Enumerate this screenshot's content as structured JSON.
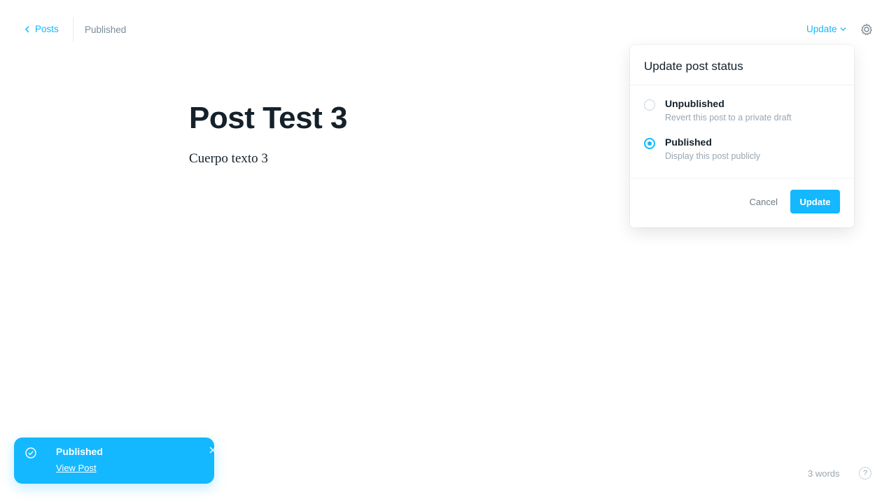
{
  "header": {
    "back_label": "Posts",
    "status_label": "Published",
    "update_label": "Update"
  },
  "editor": {
    "title": "Post Test 3",
    "body": "Cuerpo texto 3"
  },
  "popover": {
    "title": "Update post status",
    "options": [
      {
        "label": "Unpublished",
        "description": "Revert this post to a private draft",
        "checked": false
      },
      {
        "label": "Published",
        "description": "Display this post publicly",
        "checked": true
      }
    ],
    "cancel_label": "Cancel",
    "confirm_label": "Update"
  },
  "toast": {
    "title": "Published",
    "link_label": "View Post"
  },
  "footer": {
    "word_count": "3 words",
    "help_symbol": "?"
  },
  "colors": {
    "accent": "#14b8ff",
    "text": "#15212a",
    "muted": "#9aa7b0"
  },
  "icons": {
    "back": "chevron-left-icon",
    "dropdown": "chevron-down-icon",
    "settings": "gear-icon",
    "toast": "check-circle-icon",
    "close": "close-icon",
    "help": "question-icon"
  }
}
